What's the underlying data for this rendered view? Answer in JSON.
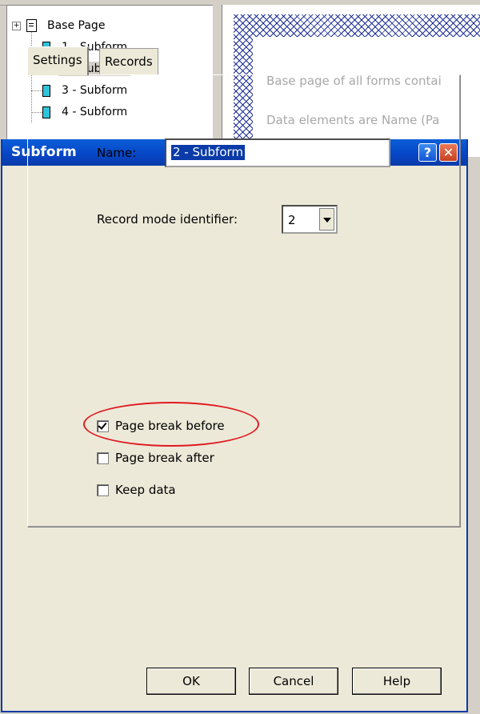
{
  "tree": {
    "root": {
      "label": "Base Page"
    },
    "items": [
      {
        "label": "1 - Subform"
      },
      {
        "label": "2 - Subform"
      },
      {
        "label": "3 - Subform"
      },
      {
        "label": "4 - Subform"
      }
    ],
    "selected_index": 1
  },
  "document": {
    "line1": "Base page of all forms contai",
    "line2": "Data elements are Name (Pa"
  },
  "dialog": {
    "title": "Subform",
    "help_glyph": "?",
    "close_glyph": "✕",
    "tabs": [
      {
        "label": "Settings",
        "active": true
      },
      {
        "label": "Records",
        "active": false
      }
    ],
    "name": {
      "label": "Name:",
      "value": "2 - Subform"
    },
    "record_mode": {
      "label": "Record mode identifier:",
      "value": "2"
    },
    "options": [
      {
        "label": "Page break before",
        "checked": true
      },
      {
        "label": "Page break after",
        "checked": false
      },
      {
        "label": "Keep data",
        "checked": false
      }
    ],
    "buttons": {
      "ok": "OK",
      "cancel": "Cancel",
      "help": "Help"
    }
  },
  "colors": {
    "title_bar": "#0a3ba8",
    "highlight": "#0a3ba8",
    "annotation": "#e01a22",
    "subform_icon": "#2fc4d9"
  }
}
